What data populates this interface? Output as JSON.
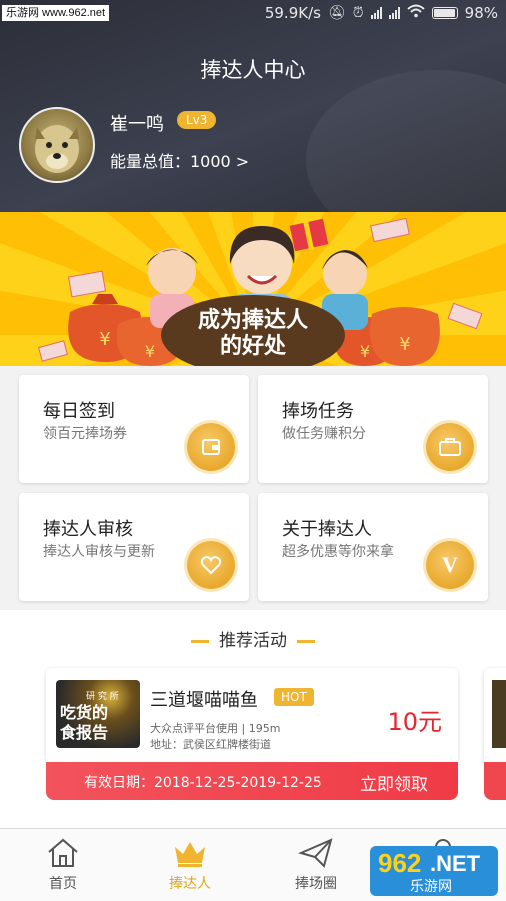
{
  "status_bar": {
    "site_tag": "乐游网 www.962.net",
    "speed": "59.9K/s",
    "battery": "98%"
  },
  "header": {
    "title": "捧达人中心",
    "user_name": "崔一鸣",
    "level": "Lv3",
    "energy": "能量总值：1000 >"
  },
  "banner": {
    "line1": "成为捧达人",
    "line2": "的好处"
  },
  "cards": [
    {
      "title": "每日签到",
      "subtitle": "领百元捧场券",
      "icon": "wallet-icon"
    },
    {
      "title": "捧场任务",
      "subtitle": "做任务赚积分",
      "icon": "briefcase-icon"
    },
    {
      "title": "捧达人审核",
      "subtitle": "捧达人审核与更新",
      "icon": "heart-icon"
    },
    {
      "title": "关于捧达人",
      "subtitle": "超多优惠等你来拿",
      "icon": "v-badge-icon"
    }
  ],
  "recommend": {
    "title": "推荐活动",
    "activity": {
      "image_text_1": "研 究 所",
      "image_text_2": "吃货的",
      "image_text_3": "食报告",
      "name": "三道堰喵喵鱼",
      "badge": "HOT",
      "platform": "大众点评平台使用 | 195m",
      "address": "地址：武侯区红牌楼街道",
      "price": "10元",
      "valid": "有效日期：2018-12-25-2019-12-25",
      "claim": "立即领取"
    }
  },
  "tabs": [
    {
      "label": "首页",
      "icon": "home-icon"
    },
    {
      "label": "捧达人",
      "icon": "crown-icon"
    },
    {
      "label": "捧场圈",
      "icon": "paper-plane-icon"
    },
    {
      "label": "",
      "icon": "person-icon"
    }
  ],
  "watermark": {
    "num": "962",
    "net": ".NET",
    "name": "乐游网"
  },
  "colors": {
    "accent": "#f0b530",
    "price_red": "#e6252e",
    "claim_bar": "#f03b46",
    "header_bg": "#2c2f38"
  }
}
